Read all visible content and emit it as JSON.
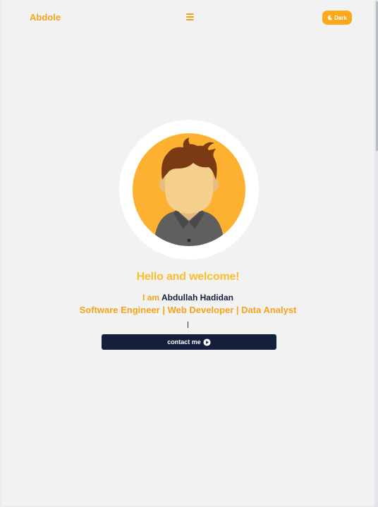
{
  "header": {
    "brand": "Abdole",
    "theme_toggle_label": "Dark",
    "menu_icon": "hamburger-icon",
    "theme_icon": "moon-icon"
  },
  "hero": {
    "avatar_icon": "user-avatar-illustration",
    "greeting": "Hello and welcome!",
    "intro_prefix": "I am",
    "name": "Abdullah Hadidan",
    "roles": "Software Engineer | Web Developer | Data Analyst",
    "typing_cursor": "|",
    "contact_label": "contact me",
    "contact_icon": "play-circle-icon"
  },
  "colors": {
    "accent": "#f8a21b",
    "greeting": "#fbbe2e",
    "dark": "#141f3c",
    "background": "#f2f2f2"
  }
}
